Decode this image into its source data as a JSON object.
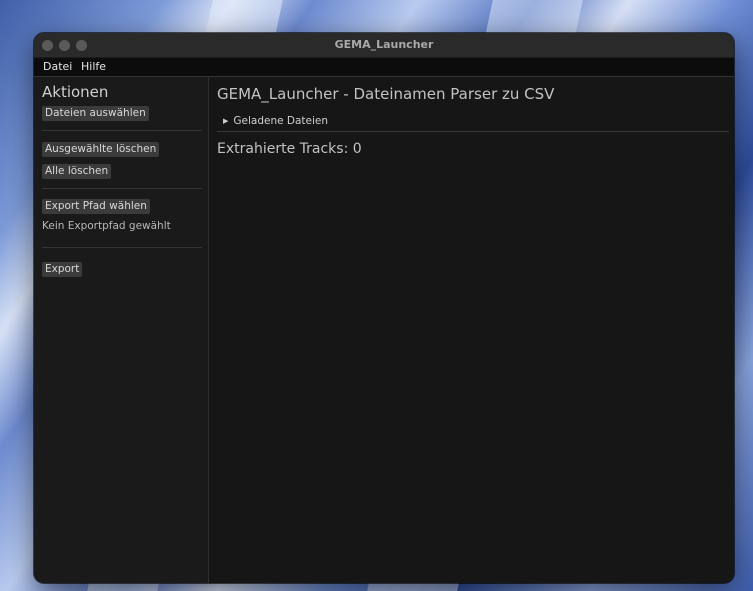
{
  "window": {
    "title": "GEMA_Launcher"
  },
  "menubar": {
    "items": [
      {
        "label": "Datei"
      },
      {
        "label": "Hilfe"
      }
    ]
  },
  "sidebar": {
    "title": "Aktionen",
    "select_files_label": "Dateien auswählen",
    "delete_selected_label": "Ausgewählte löschen",
    "delete_all_label": "Alle löschen",
    "choose_export_path_label": "Export Pfad wählen",
    "export_path_status": "Kein Exportpfad gewählt",
    "export_label": "Export"
  },
  "main": {
    "title": "GEMA_Launcher - Dateinamen Parser zu CSV",
    "loaded_files_header": "Geladene Dateien",
    "extracted_tracks": "Extrahierte Tracks: 0"
  },
  "colors": {
    "window_bg": "#161616",
    "sidebar_bg": "#1a1a1a",
    "button_bg": "#3b3b3b",
    "titlebar_bg": "#2a2a2a"
  },
  "icons": {
    "collapse_arrow": "triangle-right-icon"
  }
}
